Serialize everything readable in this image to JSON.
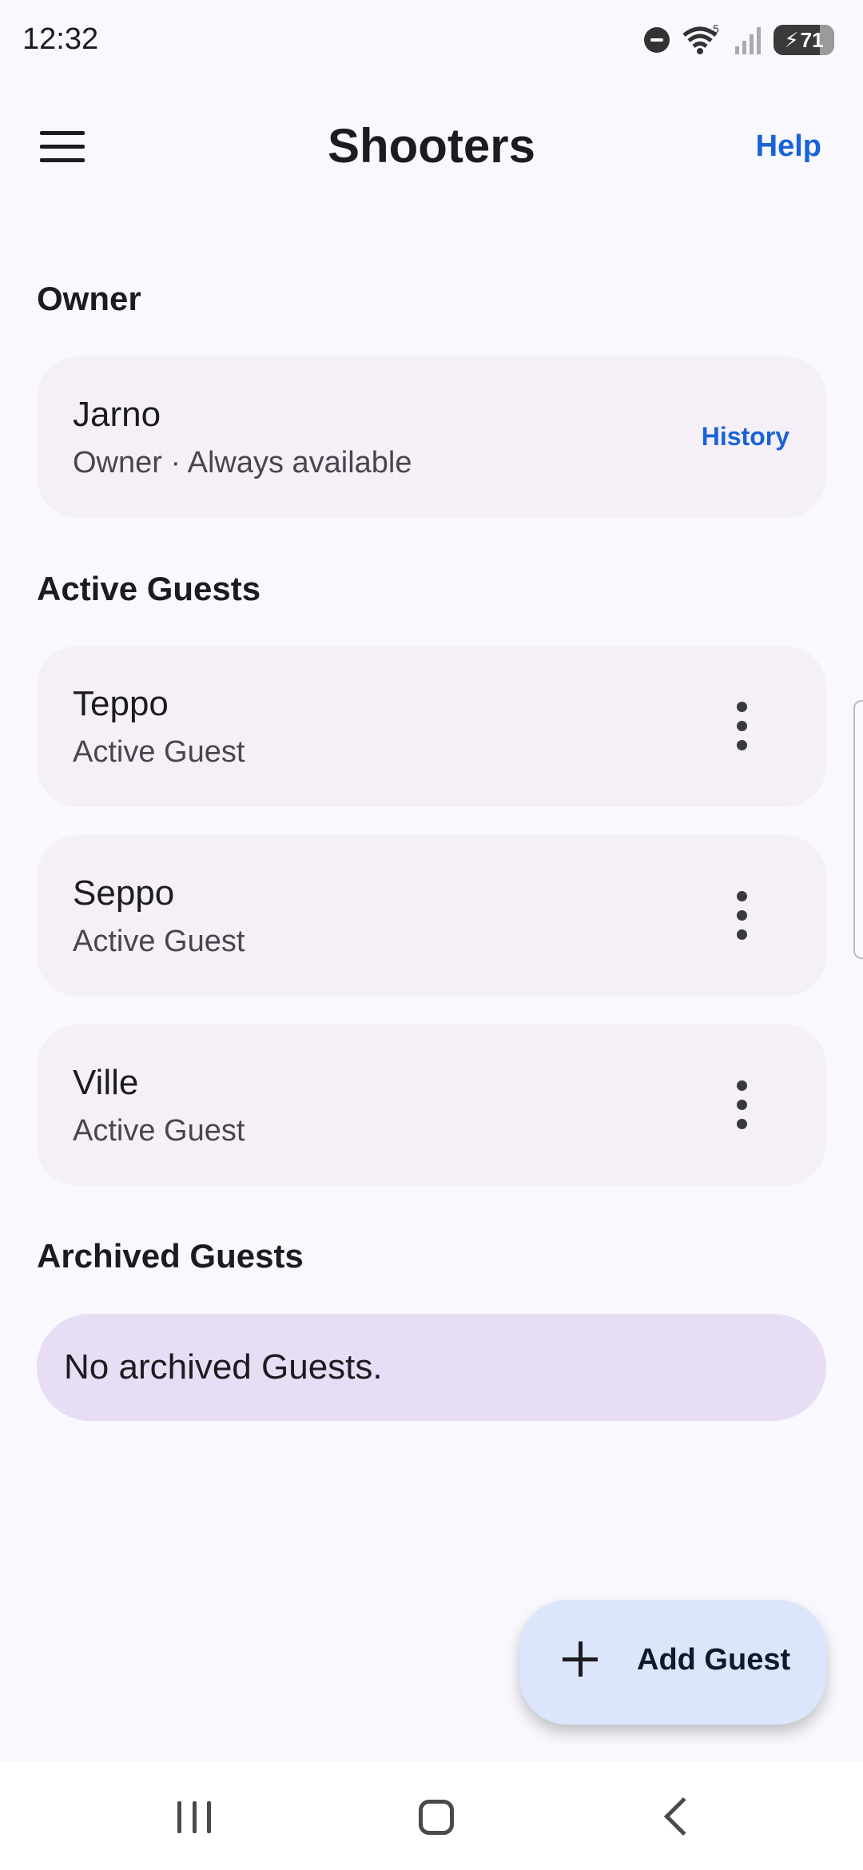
{
  "status_bar": {
    "time": "12:32",
    "wifi_badge": "5",
    "battery": "71",
    "icons": [
      "do-not-disturb-icon",
      "wifi-icon",
      "signal-icon",
      "battery-charging-icon"
    ]
  },
  "app_bar": {
    "title": "Shooters",
    "help_label": "Help",
    "menu_icon": "hamburger-menu-icon"
  },
  "owner_section": {
    "title": "Owner",
    "card": {
      "name": "Jarno",
      "subtitle": "Owner · Always available",
      "action_label": "History"
    }
  },
  "active_section": {
    "title": "Active Guests",
    "guests": [
      {
        "name": "Teppo",
        "subtitle": "Active Guest"
      },
      {
        "name": "Seppo",
        "subtitle": "Active Guest"
      },
      {
        "name": "Ville",
        "subtitle": "Active Guest"
      }
    ]
  },
  "archived_section": {
    "title": "Archived Guests",
    "empty_text": "No archived Guests."
  },
  "fab": {
    "label": "Add Guest",
    "icon": "plus-icon"
  },
  "nav_bar": {
    "icons": [
      "recents-icon",
      "home-icon",
      "back-icon"
    ]
  },
  "colors": {
    "background": "#f8f8fe",
    "card": "#f5f0f8",
    "empty_card": "#e7ddf4",
    "fab": "#dbe5fb",
    "link": "#1a63d6"
  }
}
